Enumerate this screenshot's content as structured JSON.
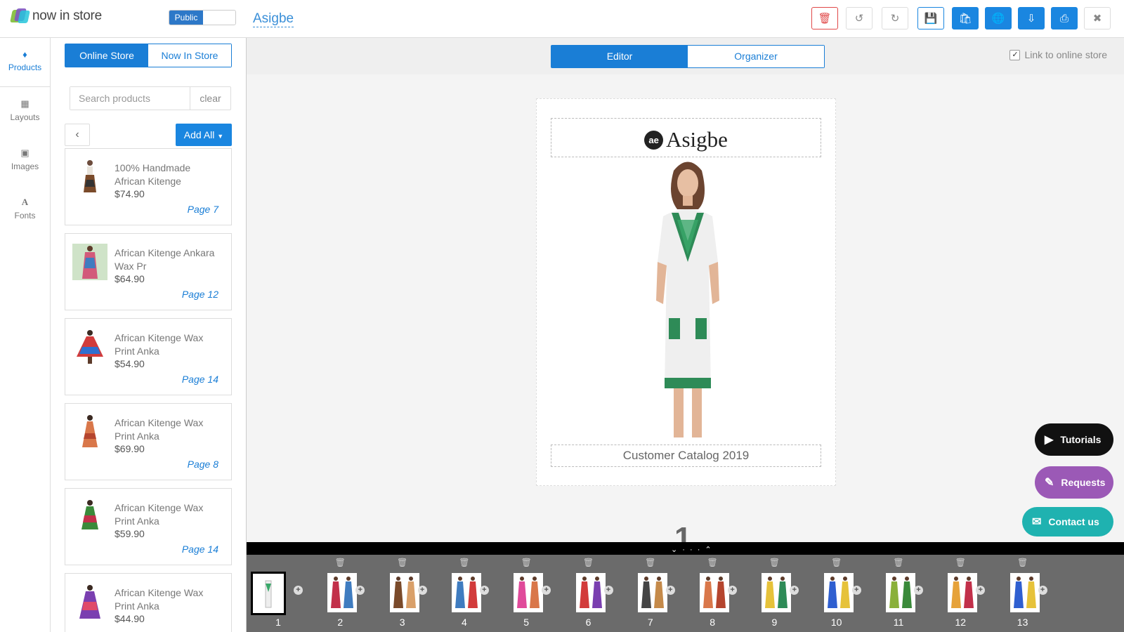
{
  "app": {
    "logo_text": "now in store",
    "public_label": "Public",
    "doc_title": "Asigbe"
  },
  "toolbar": {
    "icons": [
      "trash-icon",
      "undo-icon",
      "redo-icon",
      "save-icon",
      "shop-icon",
      "globe-icon",
      "download-icon",
      "print-icon",
      "close-icon"
    ]
  },
  "rail": {
    "items": [
      {
        "label": "Products",
        "icon": "tag-icon"
      },
      {
        "label": "Layouts",
        "icon": "grid-icon"
      },
      {
        "label": "Images",
        "icon": "image-icon"
      },
      {
        "label": "Fonts",
        "icon": "font-icon"
      }
    ]
  },
  "panel": {
    "tabs": {
      "online": "Online Store",
      "now": "Now In Store"
    },
    "search": {
      "placeholder": "Search products",
      "clear": "clear"
    },
    "add_all": "Add All",
    "products": [
      {
        "name": "100% Handmade African Kitenge",
        "price": "$74.90",
        "page": "Page 7"
      },
      {
        "name": "African Kitenge Ankara Wax Pr",
        "price": "$64.90",
        "page": "Page 12"
      },
      {
        "name": "African Kitenge Wax Print Anka",
        "price": "$54.90",
        "page": "Page 14"
      },
      {
        "name": "African Kitenge Wax Print Anka",
        "price": "$69.90",
        "page": "Page 8"
      },
      {
        "name": "African Kitenge Wax Print Anka",
        "price": "$59.90",
        "page": "Page 14"
      },
      {
        "name": "African Kitenge Wax Print Anka",
        "price": "$44.90",
        "page": ""
      }
    ]
  },
  "editor": {
    "tabs": {
      "editor": "Editor",
      "organizer": "Organizer"
    },
    "link_store": "Link to online store",
    "brand_mark": "ae",
    "brand_name": "Asigbe",
    "caption": "Customer Catalog 2019",
    "current_page": "1"
  },
  "help": {
    "tutorials": "Tutorials",
    "requests": "Requests",
    "contact": "Contact us"
  },
  "pages": [
    "1",
    "2",
    "3",
    "4",
    "5",
    "6",
    "7",
    "8",
    "9",
    "10",
    "11",
    "12",
    "13"
  ],
  "colors": {
    "primary": "#1a86e0",
    "danger": "#e04848",
    "requests": "#9b59b6",
    "contact": "#1fb2b0"
  }
}
